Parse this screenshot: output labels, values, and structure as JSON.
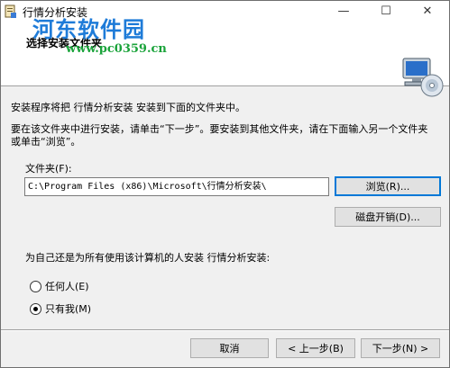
{
  "window": {
    "title": "行情分析安装",
    "controls": {
      "minimize": "—",
      "maximize": "☐",
      "close": "✕"
    }
  },
  "watermark": {
    "name": "河东软件园",
    "url": "www.pc0359.cn"
  },
  "banner": {
    "title": "选择安装文件夹",
    "icon": "computer-disc-icon"
  },
  "body": {
    "description": "安装程序将把 行情分析安装 安装到下面的文件夹中。",
    "instructions": "要在该文件夹中进行安装，请单击“下一步”。要安装到其他文件夹，请在下面输入另一个文件夹或单击“浏览”。",
    "folder_label": "文件夹(F):",
    "folder_value": "C:\\Program Files (x86)\\Microsoft\\行情分析安装\\",
    "browse_label": "浏览(R)...",
    "disk_cost_label": "磁盘开销(D)...",
    "install_for_label": "为自己还是为所有使用该计算机的人安装 行情分析安装:",
    "options": [
      {
        "label": "任何人(E)",
        "selected": false
      },
      {
        "label": "只有我(M)",
        "selected": true
      }
    ]
  },
  "footer": {
    "cancel_label": "取消",
    "back_label": "< 上一步(B)",
    "next_label": "下一步(N) >"
  }
}
